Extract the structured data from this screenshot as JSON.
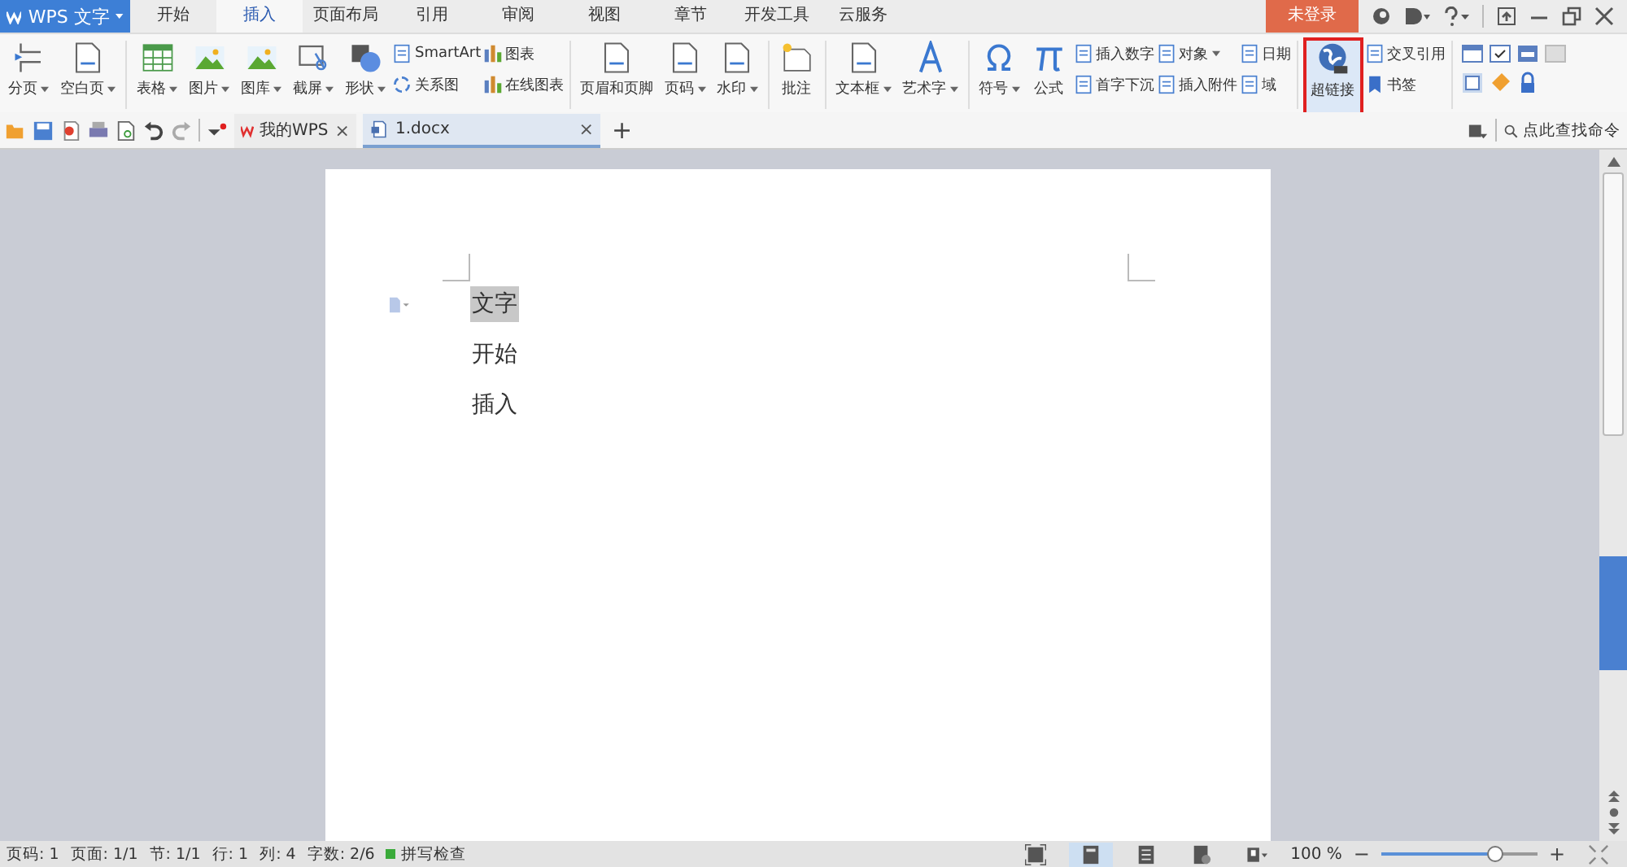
{
  "app_menu": {
    "label": "WPS 文字"
  },
  "tabs": [
    {
      "label": "开始",
      "selected": false
    },
    {
      "label": "插入",
      "selected": true
    },
    {
      "label": "页面布局",
      "selected": false
    },
    {
      "label": "引用",
      "selected": false
    },
    {
      "label": "审阅",
      "selected": false
    },
    {
      "label": "视图",
      "selected": false
    },
    {
      "label": "章节",
      "selected": false
    },
    {
      "label": "开发工具",
      "selected": false
    },
    {
      "label": "云服务",
      "selected": false
    }
  ],
  "login": {
    "label": "未登录"
  },
  "ribbon": [
    {
      "items": [
        {
          "kind": "large",
          "label": "分页",
          "dropdown": true,
          "selected": false
        },
        {
          "kind": "large",
          "label": "空白页",
          "dropdown": true,
          "selected": false
        }
      ]
    },
    {
      "items": [
        {
          "kind": "large",
          "label": "表格",
          "dropdown": true,
          "selected": false
        },
        {
          "kind": "large",
          "label": "图片",
          "dropdown": true,
          "selected": false
        },
        {
          "kind": "large",
          "label": "图库",
          "dropdown": true,
          "selected": false
        },
        {
          "kind": "large",
          "label": "截屏",
          "dropdown": true,
          "selected": false
        },
        {
          "kind": "large",
          "label": "形状",
          "dropdown": true,
          "selected": false
        },
        {
          "kind": "stack",
          "rows": [
            {
              "label": "SmartArt",
              "dropdown": false
            },
            {
              "label": "关系图",
              "dropdown": false
            }
          ]
        },
        {
          "kind": "stack",
          "rows": [
            {
              "label": "图表",
              "dropdown": false
            },
            {
              "label": "在线图表",
              "dropdown": false
            }
          ]
        }
      ]
    },
    {
      "items": [
        {
          "kind": "large",
          "label": "页眉和页脚",
          "dropdown": false,
          "selected": false
        },
        {
          "kind": "large",
          "label": "页码",
          "dropdown": true,
          "selected": false
        },
        {
          "kind": "large",
          "label": "水印",
          "dropdown": true,
          "selected": false
        }
      ]
    },
    {
      "items": [
        {
          "kind": "large",
          "label": "批注",
          "dropdown": false,
          "selected": false
        }
      ]
    },
    {
      "items": [
        {
          "kind": "large",
          "label": "文本框",
          "dropdown": true,
          "selected": false
        },
        {
          "kind": "large",
          "label": "艺术字",
          "dropdown": true,
          "selected": false
        }
      ]
    },
    {
      "items": [
        {
          "kind": "large",
          "label": "符号",
          "dropdown": true,
          "selected": false
        },
        {
          "kind": "large",
          "label": "公式",
          "dropdown": false,
          "selected": false
        },
        {
          "kind": "stack",
          "rows": [
            {
              "label": "插入数字",
              "dropdown": false
            },
            {
              "label": "首字下沉",
              "dropdown": false
            }
          ]
        },
        {
          "kind": "stack",
          "rows": [
            {
              "label": "对象",
              "dropdown": true
            },
            {
              "label": "插入附件",
              "dropdown": false
            }
          ]
        },
        {
          "kind": "stack",
          "rows": [
            {
              "label": "日期",
              "dropdown": false
            },
            {
              "label": "域",
              "dropdown": false
            }
          ]
        }
      ]
    },
    {
      "items": [
        {
          "kind": "large",
          "label": "超链接",
          "dropdown": false,
          "selected": true
        },
        {
          "kind": "stack",
          "rows": [
            {
              "label": "交叉引用",
              "dropdown": false
            },
            {
              "label": "书签",
              "dropdown": false
            }
          ]
        }
      ]
    },
    {
      "items": [
        {
          "kind": "grid"
        }
      ]
    }
  ],
  "command_search": {
    "placeholder": "点此查找命令"
  },
  "doc_tabs": [
    {
      "label": "我的WPS",
      "close": "×",
      "selected": false
    },
    {
      "label": "1.docx",
      "close": "×",
      "selected": true
    }
  ],
  "new_tab": "+",
  "document": {
    "lines": [
      {
        "text": "文字",
        "selected": true
      },
      {
        "text": "开始",
        "selected": false
      },
      {
        "text": "插入",
        "selected": false
      }
    ]
  },
  "status_bar": {
    "items": [
      "页码: 1",
      "页面: 1/1",
      "节: 1/1",
      "行: 1",
      "列: 4",
      "字数: 2/6"
    ],
    "spell_check": "拼写检查",
    "zoom": "100 %",
    "zoom_out": "−",
    "zoom_in": "+",
    "zoom_level": {
      "level": 0.73
    }
  }
}
